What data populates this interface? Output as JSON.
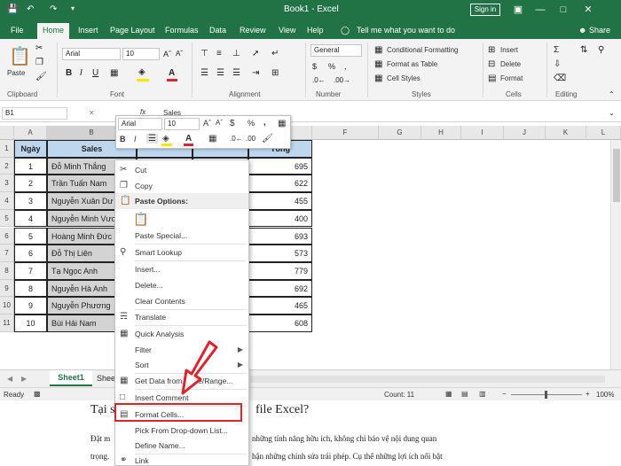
{
  "title": {
    "book": "Book1  -  Excel",
    "sign_in": "Sign in",
    "quick_access": [
      "save-icon",
      "undo-icon",
      "redo-icon",
      "customize-icon"
    ]
  },
  "tabs": [
    "File",
    "Home",
    "Insert",
    "Page Layout",
    "Formulas",
    "Data",
    "Review",
    "View",
    "Help"
  ],
  "tell_me": "Tell me what you want to do",
  "share": "Share",
  "ribbon": {
    "paste": "Paste",
    "clipboard": "Clipboard",
    "font_name": "Arial",
    "font_size": "10",
    "font_label": "Font",
    "alignment": "Alignment",
    "number_format": "General",
    "number": "Number",
    "conditional": "Conditional Formatting",
    "format_table": "Format as Table",
    "cell_styles": "Cell Styles",
    "styles": "Styles",
    "insert": "Insert",
    "delete": "Delete",
    "format": "Format",
    "cells": "Cells",
    "editing": "Editing",
    "accent": "#217346",
    "font_color": "#d9262e",
    "fill_color": "#ffe400"
  },
  "formula": {
    "name_box": "B1",
    "fx": "fx",
    "value": "Sales"
  },
  "columns": [
    "A",
    "B",
    "C",
    "D",
    "E",
    "F",
    "G",
    "H",
    "I",
    "J",
    "K",
    "L"
  ],
  "rows": [
    "1",
    "2",
    "3",
    "4",
    "5",
    "6",
    "7",
    "8",
    "9",
    "10",
    "11"
  ],
  "table": {
    "headers": [
      "Ngày",
      "Sales",
      "",
      "",
      "Tổng"
    ],
    "records": [
      {
        "day": "1",
        "name": "Đỗ Minh Thắng",
        "total": "695"
      },
      {
        "day": "2",
        "name": "Trần Tuấn Nam",
        "total": "622"
      },
      {
        "day": "3",
        "name": "Nguyễn Xuân Dư",
        "total": "455"
      },
      {
        "day": "4",
        "name": "Nguyễn Minh Vươ",
        "total": "400"
      },
      {
        "day": "5",
        "name": "Hoàng Minh Đức",
        "total": "693"
      },
      {
        "day": "6",
        "name": "Đỗ Thị Liên",
        "total": "573"
      },
      {
        "day": "7",
        "name": "Tạ Ngọc Anh",
        "total": "779"
      },
      {
        "day": "8",
        "name": "Nguyễn Hà Anh",
        "total": "692"
      },
      {
        "day": "9",
        "name": "Nguyễn Phương",
        "total": "465"
      },
      {
        "day": "10",
        "name": "Bùi Hải Nam",
        "total": "608"
      }
    ],
    "header_fill": "#bdd7ee",
    "select_fill": "#d3d3d3"
  },
  "sheets": [
    "Sheet1",
    "Shee"
  ],
  "status": {
    "ready": "Ready",
    "count": "Count: 11",
    "zoom": "100%"
  },
  "mini_toolbar": {
    "font": "Arial",
    "size": "10",
    "percent": "%",
    "comma": ","
  },
  "context_menu": {
    "cut": "Cut",
    "copy": "Copy",
    "paste_options": "Paste Options:",
    "paste_special": "Paste Special...",
    "smart_lookup": "Smart Lookup",
    "insert": "Insert...",
    "delete": "Delete...",
    "clear_contents": "Clear Contents",
    "translate": "Translate",
    "quick_analysis": "Quick Analysis",
    "filter": "Filter",
    "sort": "Sort",
    "get_data": "Get Data from Table/Range...",
    "insert_comment": "Insert Comment",
    "format_cells": "Format Cells...",
    "pick_dropdown": "Pick From Drop-down List...",
    "define_name": "Define Name...",
    "link": "Link"
  },
  "article": {
    "heading_left": "Tại s",
    "heading_right": "file Excel?",
    "line1_left": "Đặt m",
    "line1_right": "những tính năng hữu ích, không chỉ bảo vệ nội dung quan",
    "line2_left": "trọng.",
    "line2_right": "hận những chỉnh sửa trái phép. Cụ thể những lợi ích nổi bật"
  },
  "highlight_color": "#d9262e"
}
